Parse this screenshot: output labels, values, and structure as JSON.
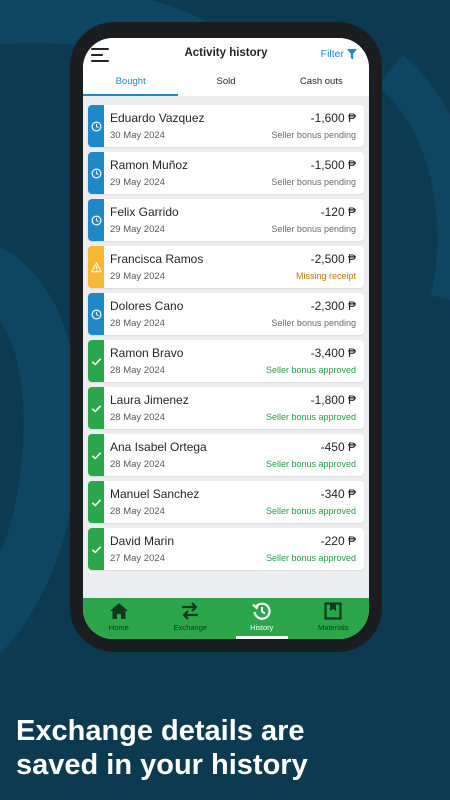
{
  "header": {
    "title": "Activity history",
    "filter_label": "Filter"
  },
  "tabs": [
    {
      "label": "Bought",
      "active": true
    },
    {
      "label": "Sold",
      "active": false
    },
    {
      "label": "Cash outs",
      "active": false
    }
  ],
  "transactions": [
    {
      "name": "Eduardo Vazquez",
      "date": "30 May 2024",
      "amount": "-1,600 ₱",
      "status": "Seller bonus pending",
      "state": "pending"
    },
    {
      "name": "Ramon Muñoz",
      "date": "29 May 2024",
      "amount": "-1,500 ₱",
      "status": "Seller bonus pending",
      "state": "pending"
    },
    {
      "name": "Felix Garrido",
      "date": "29 May 2024",
      "amount": "-120 ₱",
      "status": "Seller bonus pending",
      "state": "pending"
    },
    {
      "name": "Francisca Ramos",
      "date": "29 May 2024",
      "amount": "-2,500 ₱",
      "status": "Missing receipt",
      "state": "warning"
    },
    {
      "name": "Dolores Cano",
      "date": "28 May 2024",
      "amount": "-2,300 ₱",
      "status": "Seller bonus pending",
      "state": "pending"
    },
    {
      "name": "Ramon Bravo",
      "date": "28 May 2024",
      "amount": "-3,400 ₱",
      "status": "Seller bonus approved",
      "state": "approved"
    },
    {
      "name": "Laura Jimenez",
      "date": "28 May 2024",
      "amount": "-1,800 ₱",
      "status": "Seller bonus approved",
      "state": "approved"
    },
    {
      "name": "Ana Isabel Ortega",
      "date": "28 May 2024",
      "amount": "-450 ₱",
      "status": "Seller bonus approved",
      "state": "approved"
    },
    {
      "name": "Manuel Sanchez",
      "date": "28 May 2024",
      "amount": "-340 ₱",
      "status": "Seller bonus approved",
      "state": "approved"
    },
    {
      "name": "David Marin",
      "date": "27 May 2024",
      "amount": "-220 ₱",
      "status": "Seller bonus approved",
      "state": "approved"
    }
  ],
  "nav": [
    {
      "label": "Home",
      "icon": "home-icon",
      "active": false
    },
    {
      "label": "Exchange",
      "icon": "exchange-icon",
      "active": false
    },
    {
      "label": "History",
      "icon": "history-icon",
      "active": true
    },
    {
      "label": "Materials",
      "icon": "materials-icon",
      "active": false
    }
  ],
  "promo": {
    "line1": "Exchange details are",
    "line2": "saved in your history"
  },
  "colors": {
    "background": "#0c3a51",
    "accent_blue": "#1e88c8",
    "pending": "#1e88c8",
    "warning": "#f7b733",
    "approved": "#2ca64a",
    "nav_green": "#2ca64a"
  }
}
